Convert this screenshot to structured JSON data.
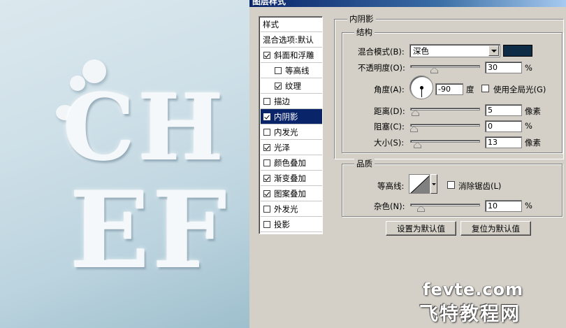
{
  "window": {
    "title": "图层样式"
  },
  "preview": {
    "text_line1": "CH",
    "text_line2": "EF"
  },
  "styles": {
    "header": "样式",
    "blend_options": "混合选项:默认",
    "items": [
      {
        "label": "斜面和浮雕",
        "checked": true,
        "indent": false
      },
      {
        "label": "等高线",
        "checked": false,
        "indent": true
      },
      {
        "label": "纹理",
        "checked": true,
        "indent": true
      },
      {
        "label": "描边",
        "checked": false,
        "indent": false
      },
      {
        "label": "内阴影",
        "checked": true,
        "indent": false,
        "selected": true
      },
      {
        "label": "内发光",
        "checked": false,
        "indent": false
      },
      {
        "label": "光泽",
        "checked": true,
        "indent": false
      },
      {
        "label": "颜色叠加",
        "checked": false,
        "indent": false
      },
      {
        "label": "渐变叠加",
        "checked": true,
        "indent": false
      },
      {
        "label": "图案叠加",
        "checked": true,
        "indent": false
      },
      {
        "label": "外发光",
        "checked": false,
        "indent": false
      },
      {
        "label": "投影",
        "checked": false,
        "indent": false
      }
    ]
  },
  "panel": {
    "title": "内阴影",
    "structure": {
      "title": "结构",
      "blend_mode_label": "混合模式(B):",
      "blend_mode_value": "深色",
      "shadow_color": "#0f2c47",
      "opacity_label": "不透明度(O):",
      "opacity_value": "30",
      "opacity_unit": "%",
      "opacity_level": 0.3,
      "angle_label": "角度(A):",
      "angle_value": "-90",
      "angle_unit": "度",
      "global_light_label": "使用全局光(G)",
      "global_light_checked": false,
      "distance_label": "距离(D):",
      "distance_value": "5",
      "distance_unit": "像素",
      "distance_level": 0.02,
      "choke_label": "阻塞(C):",
      "choke_value": "0",
      "choke_unit": "%",
      "choke_level": 0,
      "size_label": "大小(S):",
      "size_value": "13",
      "size_unit": "像素",
      "size_level": 0.05
    },
    "quality": {
      "title": "品质",
      "contour_label": "等高线:",
      "antialias_label": "消除锯齿(L)",
      "antialias_checked": false,
      "noise_label": "杂色(N):",
      "noise_value": "10",
      "noise_unit": "%",
      "noise_level": 0.1
    },
    "buttons": {
      "make_default": "设置为默认值",
      "reset_default": "复位为默认值"
    }
  },
  "watermark": {
    "line1": "fevte.com",
    "line2": "飞特教程网"
  }
}
